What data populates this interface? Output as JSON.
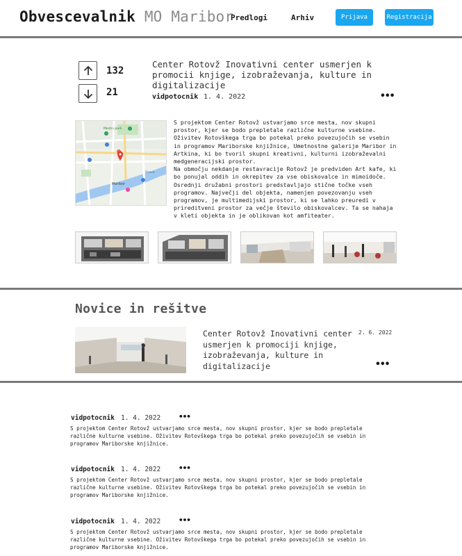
{
  "header": {
    "logo_bold": "Obvescevalnik",
    "logo_light": "MO Maribor",
    "nav": [
      "Predlogi",
      "Arhiv"
    ],
    "login_label": "Prijava",
    "register_label": "Registracija",
    "accent": "#1aa7f0"
  },
  "post": {
    "upvotes": "132",
    "downvotes": "21",
    "title": "Center Rotovž Inovativni center usmerjen k promocii knjige, izobraževanja, kulture in digitalizacije",
    "author": "vidpotocnik",
    "date": "1. 4. 2022",
    "more": "•••",
    "paragraph1": "S projektom Center Rotovž ustvarjamo srce mesta, nov skupni prostor, kjer se bodo prepletale različne kulturne vsebine. Oživitev Rotovškega trga bo potekal preko povezujočih se vsebin in programov Mariborske knjižnice, Umetnostne galerije Maribor in Artkina, ki bo tvoril skupni kreativni, kulturni izobraževalni medgeneracijski prostor.",
    "paragraph2": "Na območju nekdanje restavracije Rotovž je predviden Art kafe, ki bo ponujal oddih in okrepitev za vse obiskovalce in mimoidoče. Osrednji družabni prostori predstavljajo stične točke vseh programov. Največji del objekta, namenjen povezovanju vseh programov, je multimedijski prostor, ki se lahko preuredi v prireditveni prostor za večje število obiskovalcev. Ta se nahaja v kleti objekta in je oblikovan kot amfiteater.",
    "map_labels": {
      "city": "Maribor",
      "park": "Mestni park",
      "river": "Drava"
    }
  },
  "news": {
    "heading": "Novice in rešitve",
    "title": "Center Rotovž Inovativni center usmerjen k promociji knjige, izobraževanja, kulture in digitalizacije",
    "date": "2. 6. 2022",
    "more": "•••"
  },
  "comments": [
    {
      "author": "vidpotocnik",
      "date": "1. 4. 2022",
      "more": "•••",
      "text": "S projektom Center Rotovž ustvarjamo srce mesta, nov skupni prostor, kjer se bodo prepletale različne kulturne vsebine. Oživitev Rotovškega trga bo potekal preko povezujočih se vsebin in programov Mariborske knjižnice."
    },
    {
      "author": "vidpotocnik",
      "date": "1. 4. 2022",
      "more": "•••",
      "text": "S projektom Center Rotovž ustvarjamo srce mesta, nov skupni prostor, kjer se bodo prepletale različne kulturne vsebine. Oživitev Rotovškega trga bo potekal preko povezujočih se vsebin in programov Mariborske knjižnice."
    },
    {
      "author": "vidpotocnik",
      "date": "1. 4. 2022",
      "more": "•••",
      "text": "S projektom Center Rotovž ustvarjamo srce mesta, nov skupni prostor, kjer se bodo prepletale različne kulturne vsebine. Oživitev Rotovškega trga bo potekal preko povezujočih se vsebin in programov Mariborske knjižnice."
    }
  ]
}
